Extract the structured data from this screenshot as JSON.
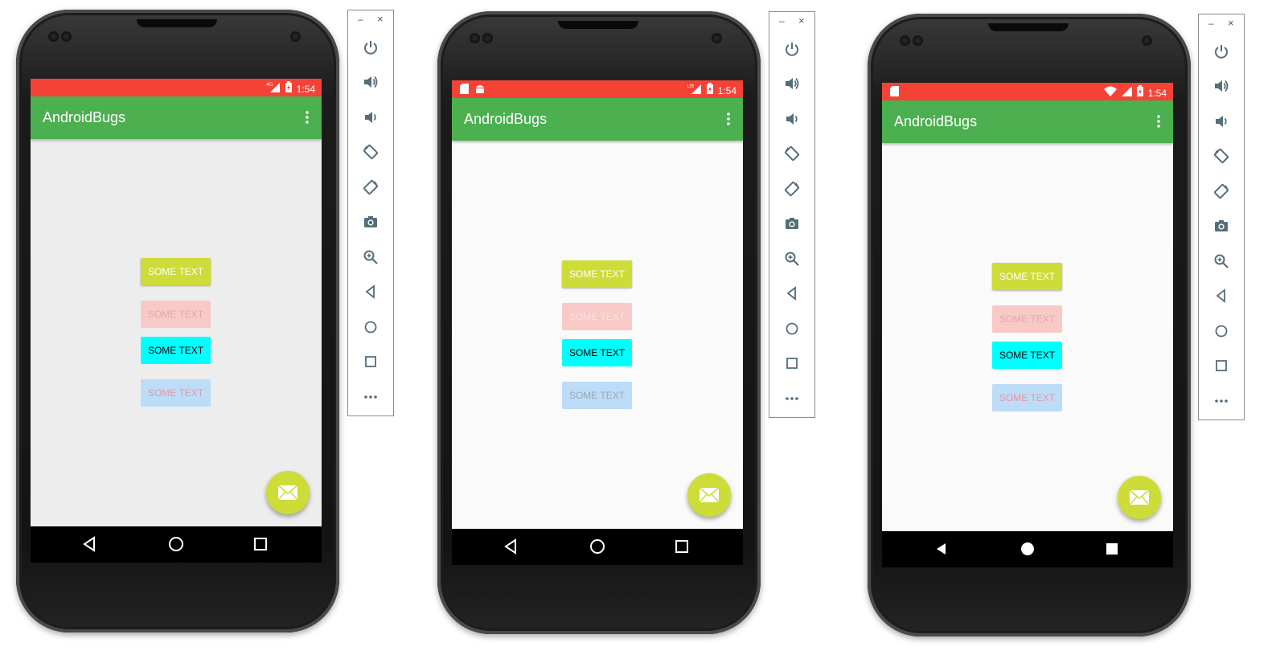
{
  "devices": [
    {
      "id": "left",
      "app_title": "AndroidBugs",
      "status_time": "1:54",
      "network_label": "4G",
      "status_left_icons": [],
      "status_right_icons": [
        "4g-signal-icon",
        "battery-charging-icon"
      ],
      "screen_bg": "#ededed",
      "nav_style": "outline",
      "buttons": [
        {
          "label": "SOME TEXT",
          "style": "lime-bg-white-text"
        },
        {
          "label": "SOME TEXT",
          "style": "pink-bg-disabled"
        },
        {
          "label": "SOME TEXT",
          "style": "cyan-bg-black-text"
        },
        {
          "label": "SOME TEXT",
          "style": "blue-bg-pink-text"
        }
      ]
    },
    {
      "id": "middle",
      "app_title": "AndroidBugs",
      "status_time": "1:54",
      "network_label": "LTE",
      "status_left_icons": [
        "sd-card-icon",
        "android-icon"
      ],
      "status_right_icons": [
        "lte-signal-icon",
        "battery-charging-icon"
      ],
      "screen_bg": "#fafafa",
      "nav_style": "outline",
      "buttons": [
        {
          "label": "SOME TEXT",
          "style": "lime-bg-white-text"
        },
        {
          "label": "SOME TEXT",
          "style": "pink-bg-disabled"
        },
        {
          "label": "SOME TEXT",
          "style": "cyan-bg-black-text"
        },
        {
          "label": "SOME TEXT",
          "style": "blue-bg-gray-text"
        }
      ]
    },
    {
      "id": "right",
      "app_title": "AndroidBugs",
      "status_time": "1:54",
      "network_label": "",
      "status_left_icons": [
        "sd-card-icon"
      ],
      "status_right_icons": [
        "wifi-icon",
        "signal-icon",
        "battery-charging-icon"
      ],
      "screen_bg": "#fafafa",
      "nav_style": "filled",
      "buttons": [
        {
          "label": "SOME TEXT",
          "style": "lime-bg-white-text"
        },
        {
          "label": "SOME TEXT",
          "style": "pink-bg-disabled"
        },
        {
          "label": "SOME TEXT",
          "style": "cyan-bg-black-text"
        },
        {
          "label": "SOME TEXT",
          "style": "blue-bg-pink-text"
        }
      ]
    }
  ],
  "emulator_toolbar": {
    "window_controls": [
      "–",
      "×"
    ],
    "items": [
      "power-icon",
      "volume-up-icon",
      "volume-down-icon",
      "rotate-left-icon",
      "rotate-right-icon",
      "camera-icon",
      "zoom-icon",
      "back-icon",
      "home-icon",
      "overview-icon",
      "more-icon"
    ]
  },
  "colors": {
    "status_bar": "#f44336",
    "app_bar": "#4caf50",
    "fab": "#cddc39",
    "button_lime": "#cddc39",
    "button_pink": "#f8c9c7",
    "button_cyan": "#00ffff",
    "button_blue": "#bcdcf8"
  }
}
